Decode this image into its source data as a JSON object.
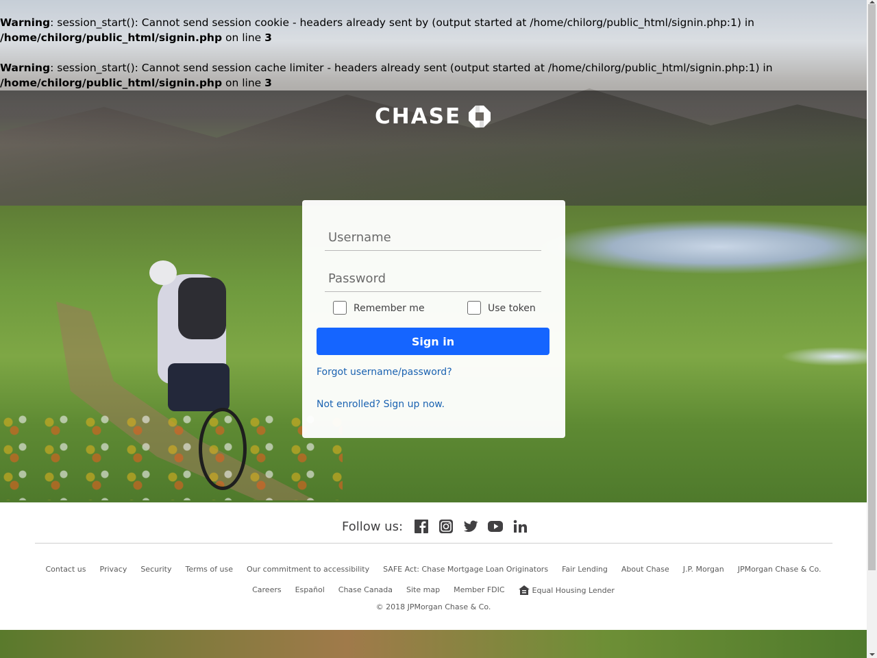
{
  "warnings": [
    {
      "label": "Warning",
      "line1": ": session_start(): Cannot send session cookie - headers already sent by (output started at /home/chilorg/public_html/signin.php:1) in",
      "path": "/home/chilorg/public_html/signin.php",
      "on_line": " on line ",
      "line_num": "3"
    },
    {
      "label": "Warning",
      "line1": ": session_start(): Cannot send session cache limiter - headers already sent (output started at /home/chilorg/public_html/signin.php:1) in",
      "path": "/home/chilorg/public_html/signin.php",
      "on_line": " on line ",
      "line_num": "3"
    }
  ],
  "brand": {
    "name": "CHASE",
    "icon": "chase-octagon-logo"
  },
  "login": {
    "username_placeholder": "Username",
    "username_value": "",
    "password_placeholder": "Password",
    "password_value": "",
    "remember_label": "Remember me",
    "token_label": "Use token",
    "signin_label": "Sign in",
    "forgot_link": "Forgot username/password?",
    "enroll_link": "Not enrolled? Sign up now."
  },
  "footer": {
    "follow_label": "Follow us:",
    "social": [
      "facebook-icon",
      "instagram-icon",
      "twitter-icon",
      "youtube-icon",
      "linkedin-icon"
    ],
    "links_row1": [
      "Contact us",
      "Privacy",
      "Security",
      "Terms of use",
      "Our commitment to accessibility",
      "SAFE Act: Chase Mortgage Loan Originators",
      "Fair Lending",
      "About Chase",
      "J.P. Morgan",
      "JPMorgan Chase & Co."
    ],
    "links_row2": [
      "Careers",
      "Español",
      "Chase Canada",
      "Site map",
      "Member FDIC",
      "Equal Housing Lender"
    ],
    "copyright": "© 2018 JPMorgan Chase & Co."
  },
  "colors": {
    "primary_button": "#1565ff",
    "link": "#1a62b1"
  }
}
